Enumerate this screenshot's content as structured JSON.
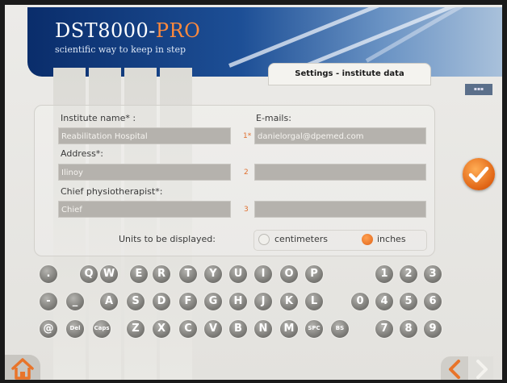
{
  "header": {
    "logo_title": "DST8000-",
    "logo_title_accent": "PRO",
    "logo_subtitle": "scientific way to keep in step",
    "section_title": "Settings - institute data"
  },
  "form": {
    "institute_label": "Institute name* :",
    "institute_value": "Reabilitation Hospital",
    "address_label": "Address*:",
    "address_value": "Ilinoy",
    "chief_label": "Chief physiotherapist*:",
    "chief_value": "Chief",
    "emails_label": "E-mails:",
    "emails": [
      {
        "index": "1*",
        "value": "danielorgal@dpemed.com"
      },
      {
        "index": "2",
        "value": ""
      },
      {
        "index": "3",
        "value": ""
      }
    ],
    "units_label": "Units to be displayed:",
    "units_options": [
      "centimeters",
      "inches"
    ],
    "units_selected": "inches"
  },
  "keyboard": {
    "row1": [
      ".",
      "Q",
      "W",
      "E",
      "R",
      "T",
      "Y",
      "U",
      "I",
      "O",
      "P"
    ],
    "row2": [
      "-",
      "_",
      "A",
      "S",
      "D",
      "F",
      "G",
      "H",
      "J",
      "K",
      "L"
    ],
    "row3": [
      "@",
      "Del",
      "Caps",
      "Z",
      "X",
      "C",
      "V",
      "B",
      "N",
      "M",
      "SPC",
      "BS"
    ],
    "numpad": [
      "1",
      "2",
      "3",
      "0",
      "4",
      "5",
      "6",
      "7",
      "8",
      "9"
    ]
  },
  "colors": {
    "accent": "#e8742a",
    "field_bg": "#b5b2ad",
    "key_bg": "#8a8985",
    "banner": "#0a2d6b"
  },
  "icons": {
    "confirm": "checkmark-icon",
    "home": "home-icon",
    "prev": "chevron-left-icon",
    "next": "chevron-right-icon"
  }
}
